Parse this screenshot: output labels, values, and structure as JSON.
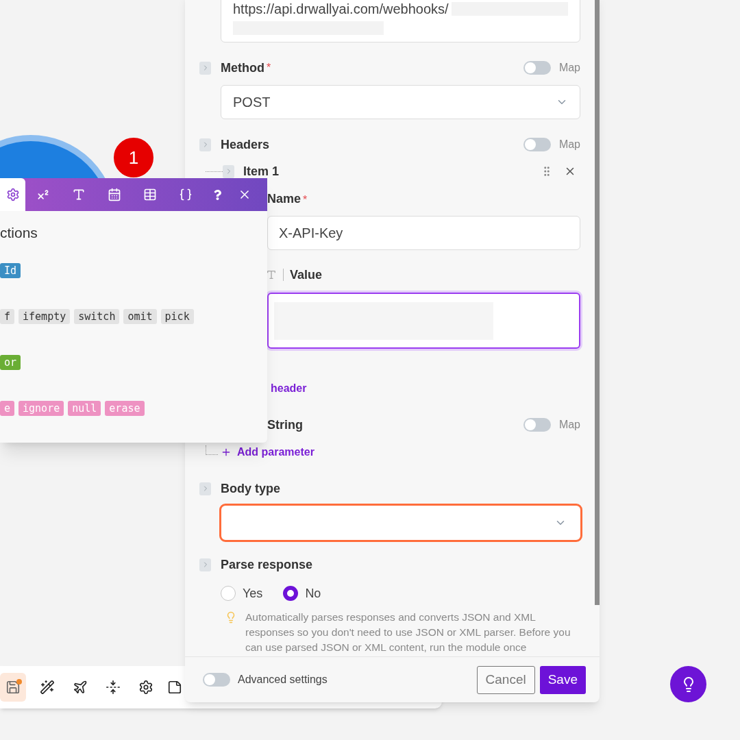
{
  "canvas": {
    "module_badge": "1",
    "toolbar": [
      {
        "selected": true,
        "notification": true
      },
      {
        "selected": false,
        "notification": false
      },
      {
        "selected": false,
        "notification": false
      },
      {
        "selected": false,
        "notification": false
      },
      {
        "selected": false,
        "notification": false
      },
      {
        "selected": false,
        "notification": false
      }
    ]
  },
  "function_popup": {
    "tabs": [
      {
        "selected": true
      },
      {
        "selected": false
      },
      {
        "selected": false
      },
      {
        "selected": false
      },
      {
        "selected": false
      },
      {
        "selected": false
      },
      {
        "selected": false
      },
      {
        "selected": false
      }
    ],
    "heading": "ctions",
    "groups": [
      {
        "color": "#3b8fc4",
        "tags": [
          "Id"
        ]
      },
      {
        "color": "#e3e3e3",
        "tags": [
          "f",
          "ifempty",
          "switch",
          "omit",
          "pick"
        ]
      },
      {
        "color": "#6aae35",
        "tags": [
          "or"
        ]
      },
      {
        "color": "#ee92c2",
        "tags": [
          "e",
          "ignore",
          "null",
          "erase"
        ]
      }
    ]
  },
  "panel": {
    "url_field": {
      "value": "https://api.drwallyai.com/webhooks/"
    },
    "method": {
      "label": "Method",
      "required_mark": "*",
      "map_on": false,
      "map_label": "Map",
      "value": "POST"
    },
    "headers": {
      "label": "Headers",
      "map_on": false,
      "map_label": "Map",
      "items": [
        {
          "label": "Item 1",
          "name_label": "Name",
          "name_required_mark": "*",
          "name_value": "X-API-Key",
          "value_label": "Value",
          "value_focused": true
        }
      ],
      "add_link": "header"
    },
    "query": {
      "label": "String",
      "map_on": false,
      "map_label": "Map",
      "add_link": "Add parameter"
    },
    "body_type": {
      "label": "Body type",
      "error": true
    },
    "parse_response": {
      "label": "Parse response",
      "options": [
        {
          "label": "Yes",
          "selected": false
        },
        {
          "label": "No",
          "selected": true
        }
      ],
      "hint": "Automatically parses responses and converts JSON and XML responses so you don't need to use JSON or XML parser. Before you can use parsed JSON or XML content, run the module once"
    },
    "footer": {
      "advanced_label": "Advanced settings",
      "advanced_on": false,
      "cancel": "Cancel",
      "save": "Save"
    }
  }
}
